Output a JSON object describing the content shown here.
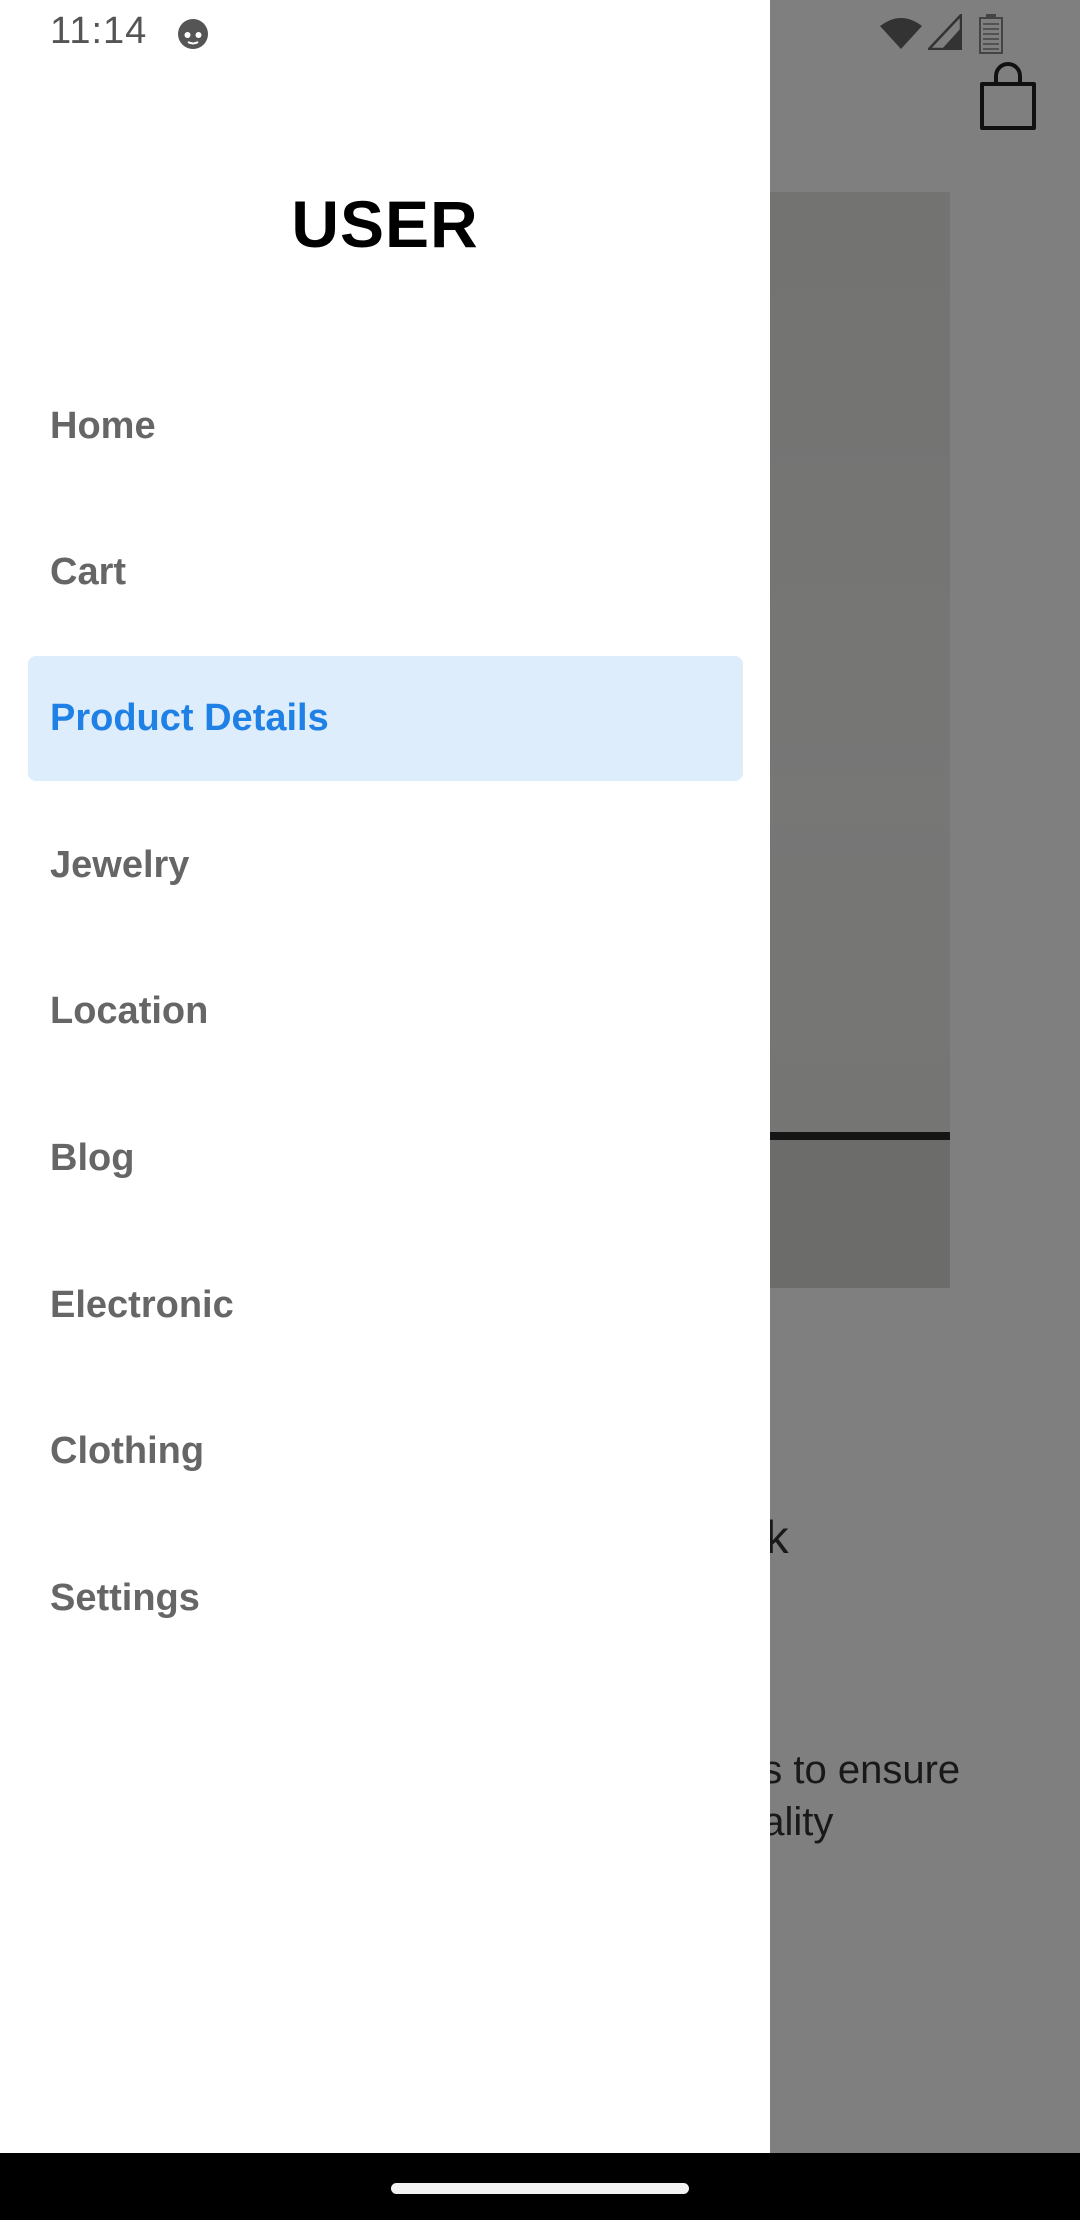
{
  "status_bar": {
    "time": "11:14",
    "icons": [
      "app-notification-icon",
      "wifi-icon",
      "cell-signal-icon",
      "battery-icon"
    ]
  },
  "drawer": {
    "title": "USER",
    "items": [
      {
        "label": "Home",
        "active": false
      },
      {
        "label": "Cart",
        "active": false
      },
      {
        "label": "Product Details",
        "active": true
      },
      {
        "label": "Jewelry",
        "active": false
      },
      {
        "label": "Location",
        "active": false
      },
      {
        "label": "Blog",
        "active": false
      },
      {
        "label": "Electronic",
        "active": false
      },
      {
        "label": "Clothing",
        "active": false
      },
      {
        "label": "Settings",
        "active": false
      }
    ]
  },
  "background": {
    "cart_icon": "shopping-bag-icon",
    "title_fragment": "nk",
    "description_line1": "es to ensure",
    "description_line2": "uality"
  },
  "colors": {
    "accent": "#1f80e6",
    "active_item_bg": "#deedfc",
    "item_text": "#666666",
    "scrim": "rgba(0,0,0,0.5)"
  }
}
